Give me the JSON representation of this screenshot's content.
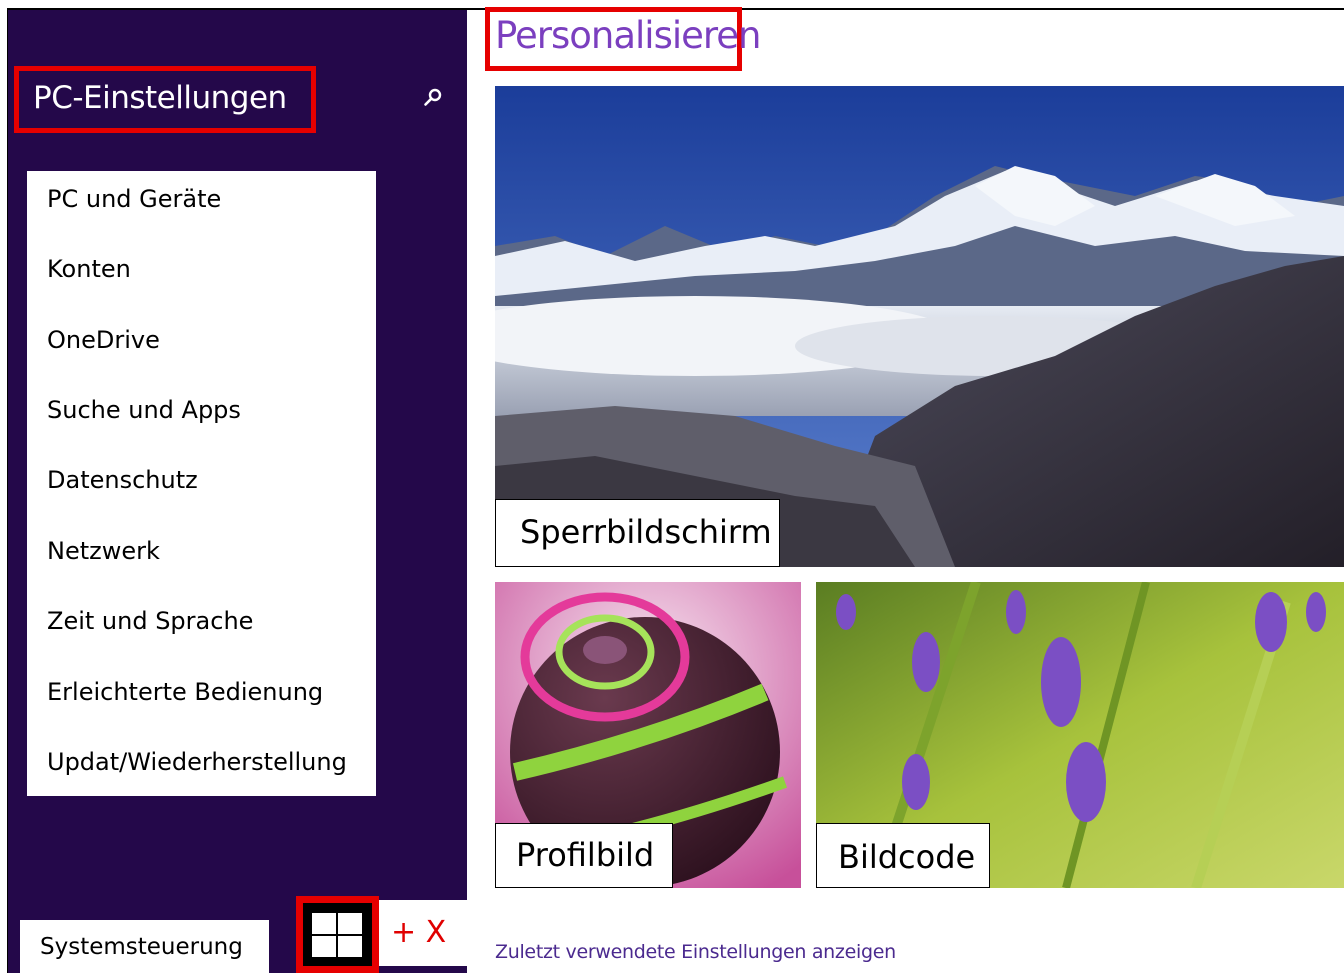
{
  "sidebar": {
    "title": "PC-Einstellungen",
    "search_icon": "search-icon",
    "items": [
      {
        "label": "PC und Geräte"
      },
      {
        "label": "Konten"
      },
      {
        "label": "OneDrive"
      },
      {
        "label": "Suche und Apps"
      },
      {
        "label": "Datenschutz"
      },
      {
        "label": "Netzwerk"
      },
      {
        "label": "Zeit und Sprache"
      },
      {
        "label": "Erleichterte Bedienung"
      },
      {
        "label": "Updat/Wiederherstellung"
      }
    ],
    "control_panel_label": "Systemsteuerung",
    "windows_key_icon": "windows-logo-icon",
    "shortcut_suffix": "+ X"
  },
  "main": {
    "heading": "Personalisieren",
    "tiles": {
      "lock_screen": "Sperrbildschirm",
      "profile_picture": "Profilbild",
      "picture_password": "Bildcode"
    },
    "recent_settings_link": "Zuletzt verwendete Einstellungen anzeigen"
  },
  "colors": {
    "sidebar_bg": "#24084a",
    "heading": "#7b3fbf",
    "highlight": "#e60000",
    "link": "#4b2a8f"
  }
}
